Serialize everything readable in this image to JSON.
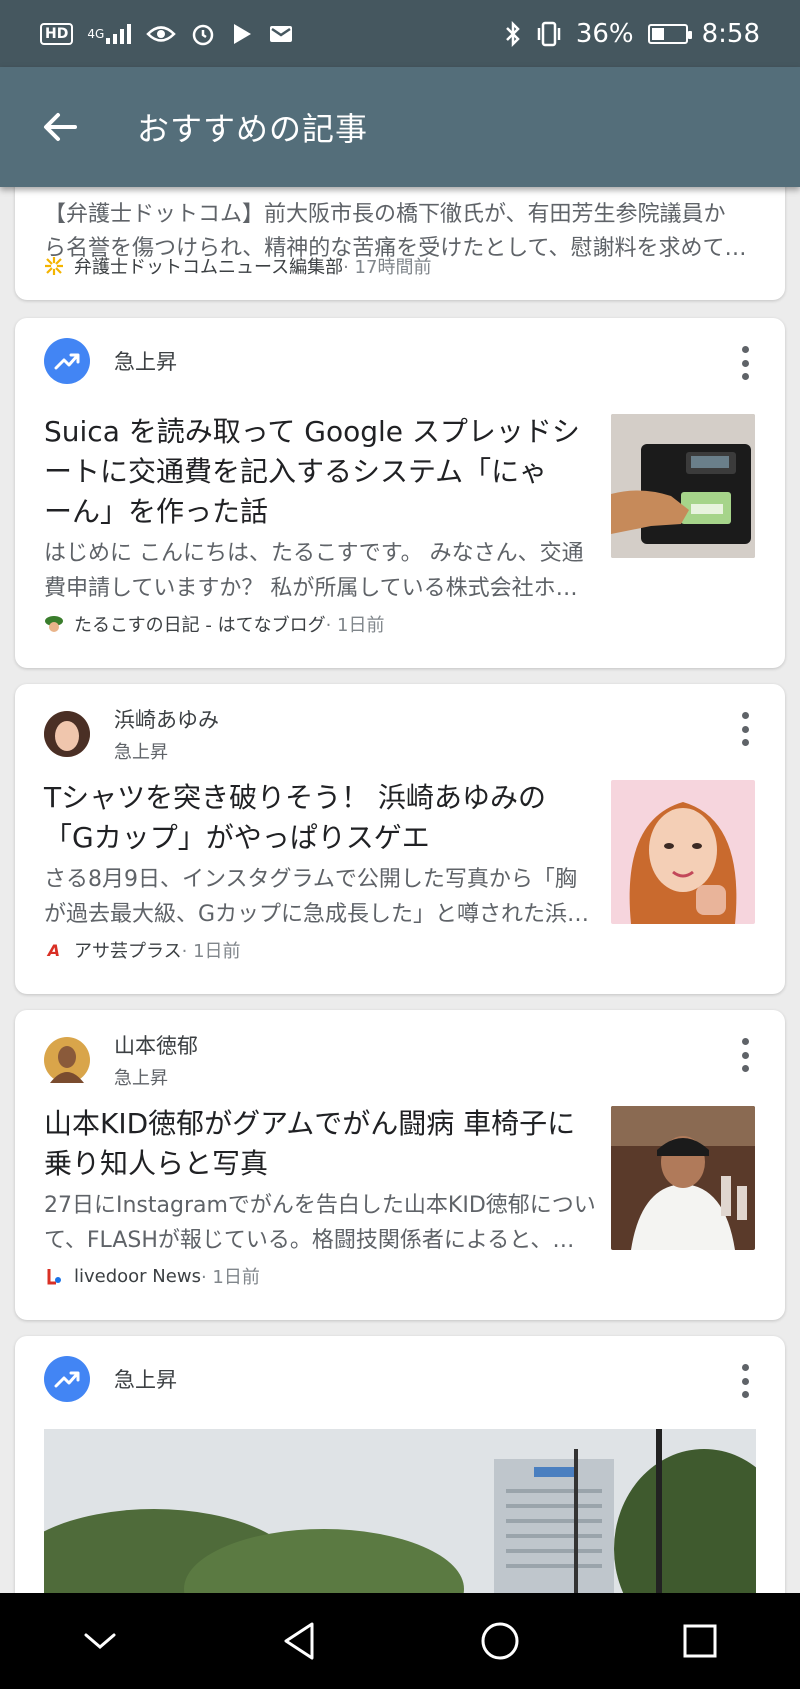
{
  "status_bar": {
    "hd": "HD",
    "network": "4G",
    "battery_text": "36%",
    "battery_level": 0.36,
    "time": "8:58"
  },
  "app_bar": {
    "title": "おすすめの記事"
  },
  "cards": [
    {
      "snippet_line1": "【弁護士ドットコム】前大阪市長の橋下徹氏が、有田芳生参院議員か",
      "snippet_line2": "ら名誉を傷つけられ、精神的な苦痛を受けたとして、慰謝料を求めて…",
      "source": "弁護士ドットコムニュース編集部",
      "time": " · 17時間前"
    },
    {
      "head_title": "急上昇",
      "headline_lines": [
        "Suica を読み取って Google スプレッドシ",
        "ートに交通費を記入するシステム「にゃ",
        "ーん」を作った話"
      ],
      "snippet_lines": [
        "はじめに こんにちは、たるこすです。 みなさん、交通",
        "費申請していますか？ 私が所属している株式会社ホ…"
      ],
      "source": "たるこすの日記 - はてなブログ",
      "time": " · 1日前"
    },
    {
      "head_title": "浜崎あゆみ",
      "head_sub": "急上昇",
      "headline_lines": [
        "Tシャツを突き破りそう！ 浜崎あゆみの",
        "「Gカップ」がやっぱりスゲエ"
      ],
      "snippet_lines": [
        "さる8月9日、インスタグラムで公開した写真から「胸",
        "が過去最大級、Gカップに急成長した」と噂された浜…"
      ],
      "source": "アサ芸プラス",
      "time": " · 1日前"
    },
    {
      "head_title": "山本徳郁",
      "head_sub": "急上昇",
      "headline_lines": [
        "山本KID徳郁がグアムでがん闘病 車椅子に",
        "乗り知人らと写真"
      ],
      "snippet_lines": [
        "27日にInstagramでがんを告白した山本KID徳郁につい",
        "て、FLASHが報じている。格闘技関係者によると、…"
      ],
      "source": "livedoor News",
      "time": " · 1日前"
    },
    {
      "head_title": "急上昇"
    }
  ],
  "icons": {
    "back": "arrow-left-icon",
    "trend": "trending-up-icon",
    "menu": "more-vert-icon",
    "nav": [
      "collapse-chevron-icon",
      "back-triangle-icon",
      "home-circle-icon",
      "recents-square-icon"
    ]
  },
  "colors": {
    "app_bar": "#546e7a",
    "status_bar": "#45575f",
    "trend": "#4285f4"
  }
}
